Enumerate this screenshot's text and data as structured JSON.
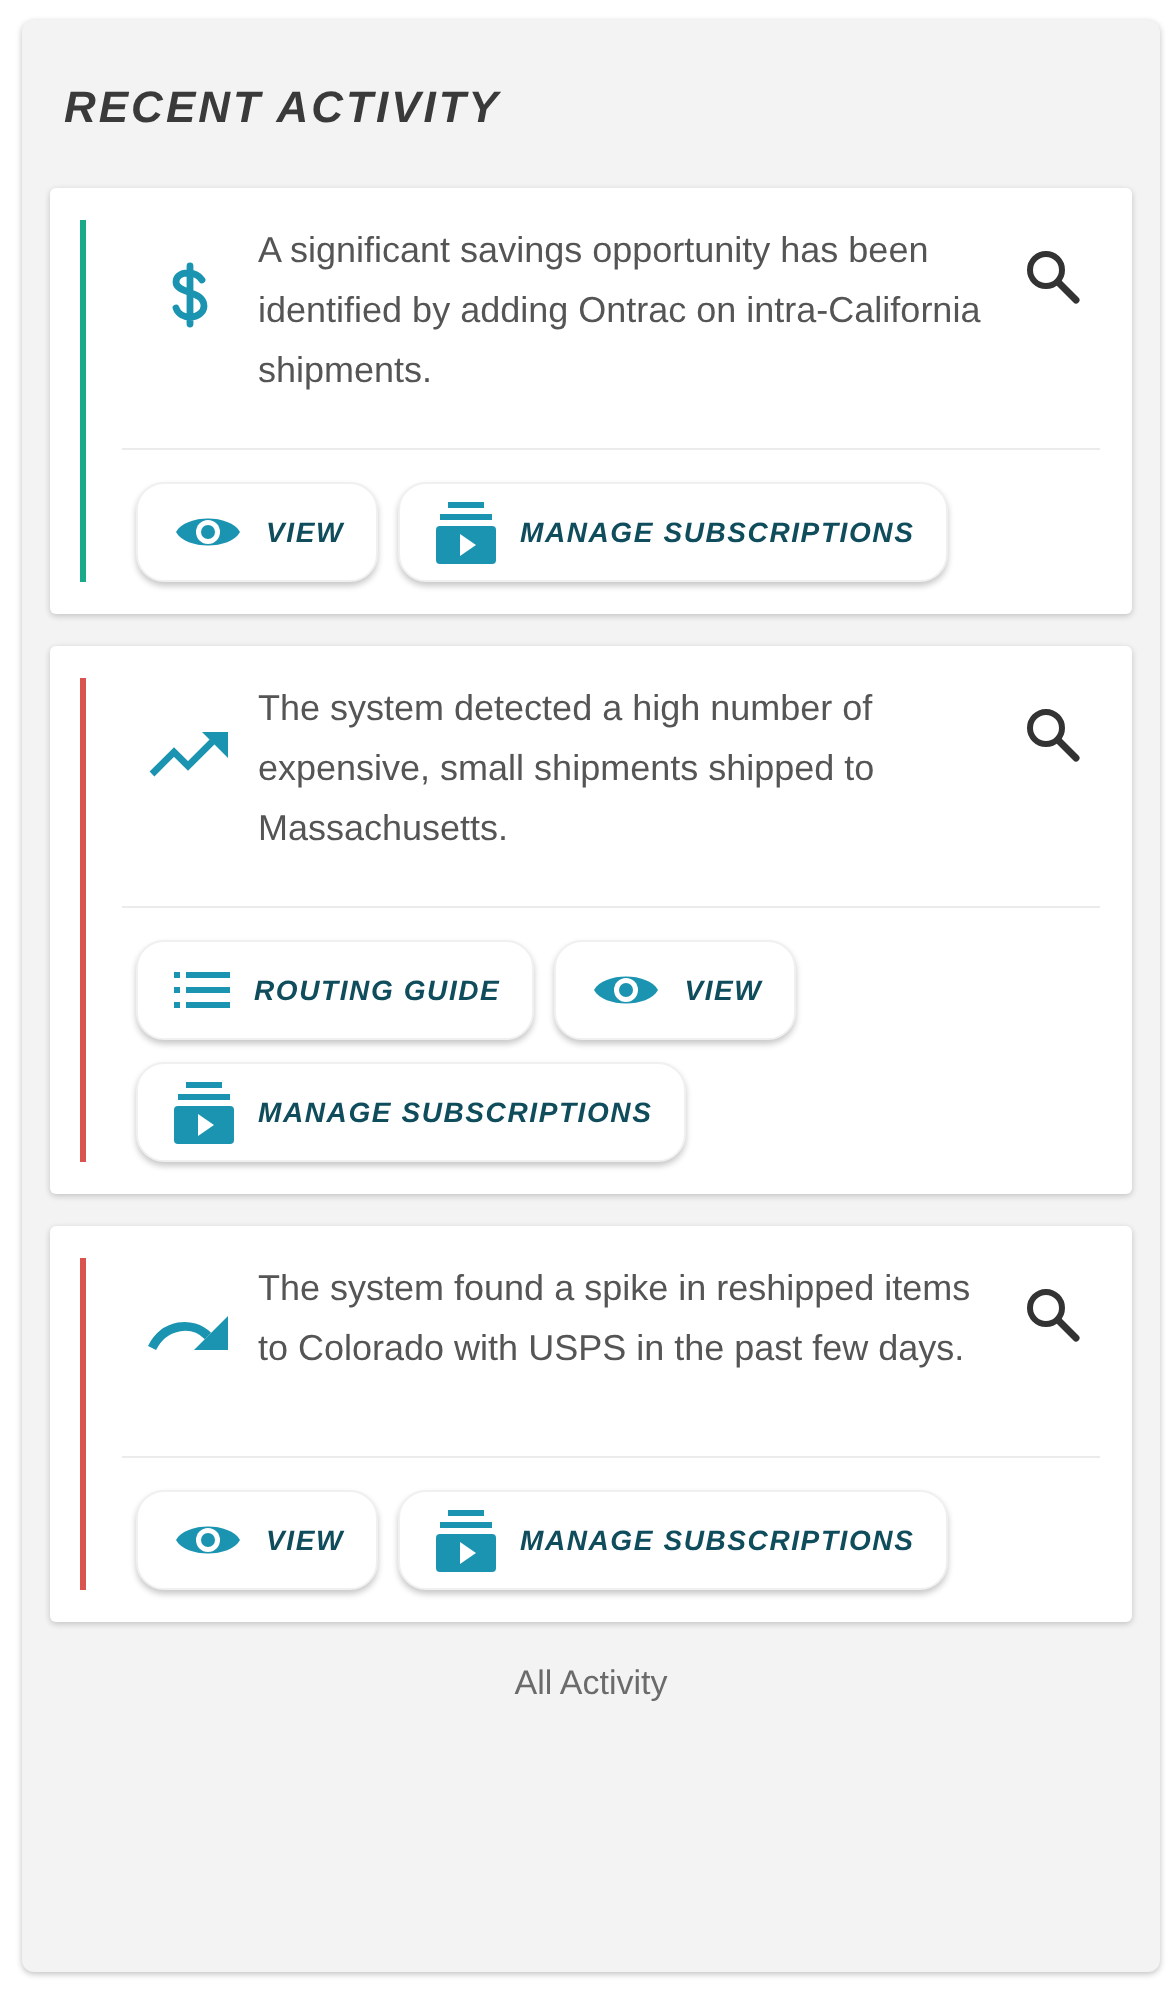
{
  "title": "RECENT ACTIVITY",
  "activities": [
    {
      "kind": "dollar",
      "color": "#1aaa8a",
      "text": "A significant savings opportunity has been identified by adding Ontrac on intra-California shipments.",
      "actions": [
        {
          "kind": "view",
          "label": "VIEW"
        },
        {
          "kind": "manage",
          "label": "MANAGE SUBSCRIPTIONS"
        }
      ]
    },
    {
      "kind": "trend",
      "color": "#d9534f",
      "text": "The system detected a high number of expensive, small shipments shipped to Massachusetts.",
      "actions": [
        {
          "kind": "routing",
          "label": "ROUTING GUIDE"
        },
        {
          "kind": "view",
          "label": "VIEW"
        },
        {
          "kind": "manage",
          "label": "MANAGE SUBSCRIPTIONS"
        }
      ]
    },
    {
      "kind": "redo",
      "color": "#d9534f",
      "text": "The system found a spike in reshipped items to Colorado with USPS in the past few days.",
      "actions": [
        {
          "kind": "view",
          "label": "VIEW"
        },
        {
          "kind": "manage",
          "label": "MANAGE SUBSCRIPTIONS"
        }
      ]
    }
  ],
  "footer_link": "All Activity"
}
